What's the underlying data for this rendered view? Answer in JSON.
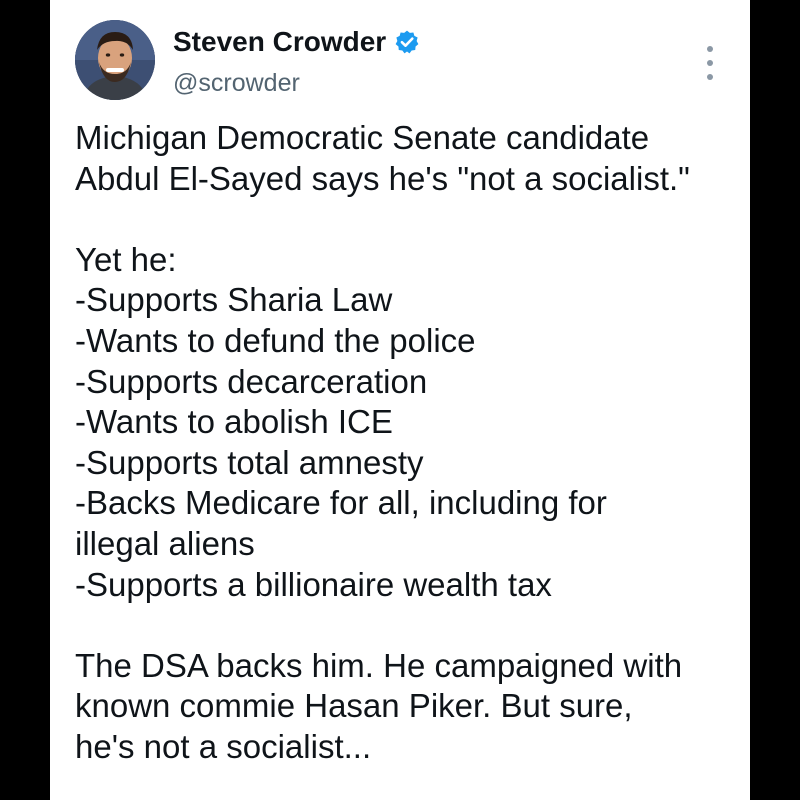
{
  "tweet": {
    "author": {
      "display_name": "Steven Crowder",
      "handle": "@scrowder",
      "verified": true,
      "verified_color": "#1d9bf0"
    },
    "icons": {
      "avatar": "profile-photo",
      "verified": "verified-badge-icon",
      "more": "more-options-icon"
    },
    "intro_lines": [
      "Michigan Democratic Senate candidate",
      "Abdul El-Sayed says he's \"not a socialist.\""
    ],
    "list_intro": "Yet he:",
    "list_items": [
      "-Supports Sharia Law",
      "-Wants to defund the police",
      "-Supports decarceration",
      "-Wants to abolish ICE",
      "-Supports total amnesty",
      "-Backs Medicare for all, including for",
      "illegal aliens",
      "-Supports a billionaire wealth tax"
    ],
    "closing_lines": [
      "The DSA backs him. He campaigned with",
      "known commie Hasan Piker. But sure,",
      "he's not a socialist..."
    ]
  },
  "colors": {
    "text": "#0f1419",
    "secondary_text": "#536471",
    "background": "#ffffff",
    "frame": "#000000"
  }
}
